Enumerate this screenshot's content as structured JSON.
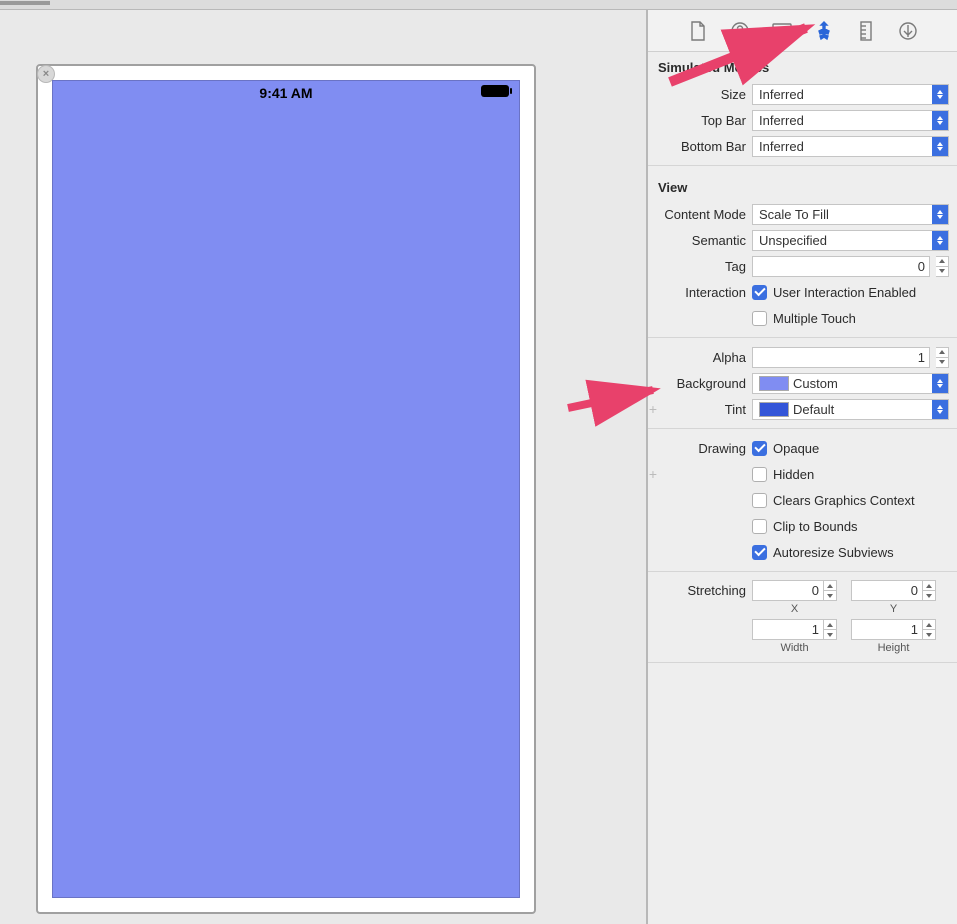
{
  "canvas": {
    "status_time": "9:41 AM",
    "view_bg": "#808df2"
  },
  "inspector": {
    "simulated_metrics": {
      "header": "Simulated Metrics",
      "size_label": "Size",
      "size_value": "Inferred",
      "top_bar_label": "Top Bar",
      "top_bar_value": "Inferred",
      "bottom_bar_label": "Bottom Bar",
      "bottom_bar_value": "Inferred"
    },
    "view": {
      "header": "View",
      "content_mode_label": "Content Mode",
      "content_mode_value": "Scale To Fill",
      "semantic_label": "Semantic",
      "semantic_value": "Unspecified",
      "tag_label": "Tag",
      "tag_value": "0",
      "interaction_label": "Interaction",
      "user_interaction_label": "User Interaction Enabled",
      "multiple_touch_label": "Multiple Touch",
      "alpha_label": "Alpha",
      "alpha_value": "1",
      "background_label": "Background",
      "background_value": "Custom",
      "background_swatch": "#808df2",
      "tint_label": "Tint",
      "tint_value": "Default",
      "tint_swatch": "#3355d8",
      "drawing_label": "Drawing",
      "opaque_label": "Opaque",
      "hidden_label": "Hidden",
      "clears_graphics_label": "Clears Graphics Context",
      "clip_to_bounds_label": "Clip to Bounds",
      "autoresize_label": "Autoresize Subviews",
      "stretching_label": "Stretching",
      "stretch_x_label": "X",
      "stretch_x_value": "0",
      "stretch_y_label": "Y",
      "stretch_y_value": "0",
      "stretch_w_label": "Width",
      "stretch_w_value": "1",
      "stretch_h_label": "Height",
      "stretch_h_value": "1"
    }
  }
}
